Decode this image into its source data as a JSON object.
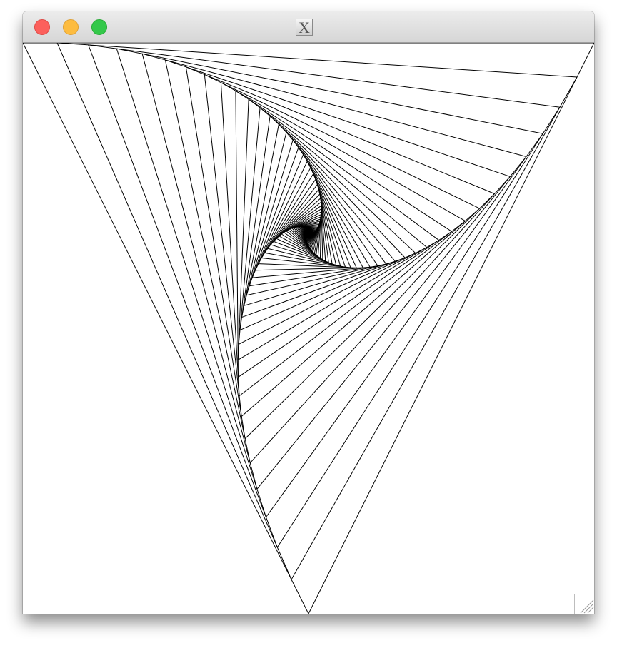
{
  "window": {
    "title_icon": "x-window-icon",
    "title_glyph": "X",
    "buttons": [
      {
        "name": "close",
        "color": "#fc605c"
      },
      {
        "name": "minimize",
        "color": "#fdbc40"
      },
      {
        "name": "zoom",
        "color": "#34c84a"
      }
    ]
  },
  "drawing": {
    "description_type": "pursuit-curve line pattern",
    "line_color": "#000000",
    "background_color": "#ffffff",
    "shape": "triangle",
    "vertices": 3,
    "steps": 72,
    "step_fraction": 0.06
  },
  "resize_grip": {
    "icon": "resize-grip-icon"
  }
}
